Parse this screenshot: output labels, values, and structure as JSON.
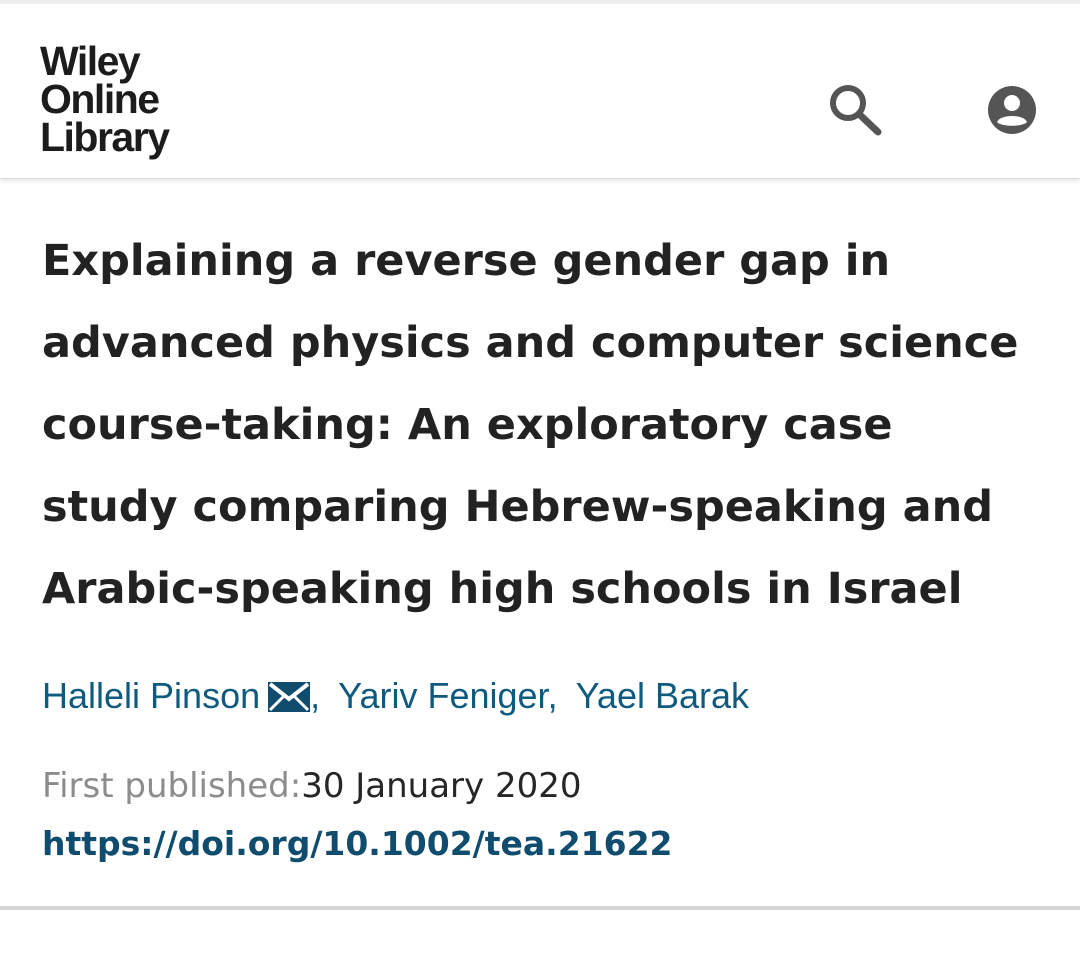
{
  "header": {
    "logo_lines": [
      "Wiley",
      "Online",
      "Library"
    ],
    "search_icon": "search-icon",
    "account_icon": "account-circle-icon"
  },
  "article": {
    "title": "Explaining a reverse gender gap in advanced physics and computer science course-taking: An exploratory case study comparing Hebrew-speaking and Arabic-speaking high schools in Israel",
    "authors": [
      {
        "name": "Halleli Pinson",
        "has_email_icon": true
      },
      {
        "name": "Yariv Feniger"
      },
      {
        "name": "Yael Barak"
      }
    ],
    "author_separator": ",",
    "published_label": "First published:",
    "published_date": "30 January 2020",
    "doi_link": "https://doi.org/10.1002/tea.21622"
  },
  "colors": {
    "link": "#0f5a7f",
    "title": "#222222",
    "muted": "#8c8c8c"
  }
}
